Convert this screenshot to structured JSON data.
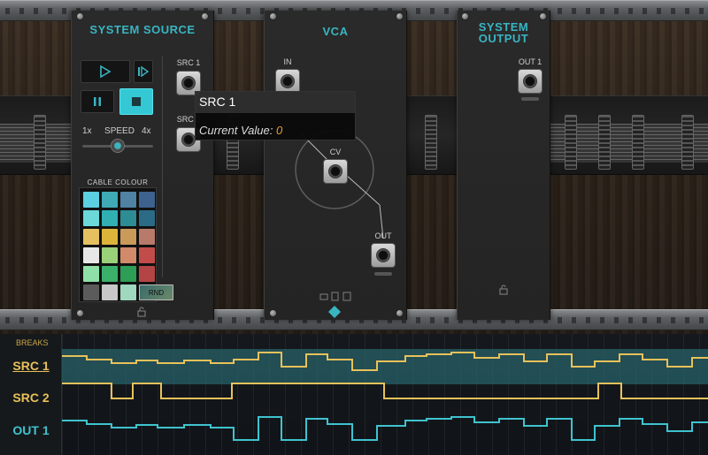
{
  "modules": {
    "system_source": {
      "title": "SYSTEM SOURCE",
      "speed_label": "SPEED",
      "speed_min": "1x",
      "speed_max": "4x",
      "cable_colour_label": "CABLE COLOUR",
      "rnd_label": "RND",
      "jacks": {
        "src1": "SRC 1",
        "src2": "SRC 2"
      },
      "swatches": [
        [
          "#5bd0e0",
          "#3fa9b6",
          "#4f82a3",
          "#3d628e"
        ],
        [
          "#6ad9d8",
          "#31b0b4",
          "#2e8c94",
          "#2b6b86"
        ],
        [
          "#e5c061",
          "#dcb43a",
          "#c99a5a",
          "#b87a6a"
        ],
        [
          "#e7e7e7",
          "#9bd07a",
          "#d18a6a",
          "#c24c4a"
        ],
        [
          "#8ee0a8",
          "#3bb06a",
          "#2e9d55",
          "#b34545"
        ],
        [
          "#5b5b5b",
          "#c8c8c8",
          "#9fd7bf",
          ""
        ]
      ]
    },
    "vca": {
      "title": "VCA",
      "jacks": {
        "in": "IN",
        "cv": "CV",
        "out": "OUT"
      }
    },
    "system_output": {
      "title_line1": "SYSTEM",
      "title_line2": "OUTPUT",
      "jacks": {
        "out1": "OUT 1"
      }
    }
  },
  "tooltip": {
    "title": "SRC 1",
    "value_label": "Current Value:",
    "value": "0"
  },
  "timeline": {
    "header": "BREAKS",
    "tracks": [
      {
        "label": "SRC 1",
        "color": "#e8c15a"
      },
      {
        "label": "SRC 2",
        "color": "#e8c15a"
      },
      {
        "label": "OUT 1",
        "color": "#3fc3cf"
      }
    ]
  },
  "colors": {
    "accent": "#39b5c2",
    "active_button": "#34c8d4",
    "waveform_yellow": "#e8c15a",
    "waveform_teal": "#3fc3cf"
  }
}
